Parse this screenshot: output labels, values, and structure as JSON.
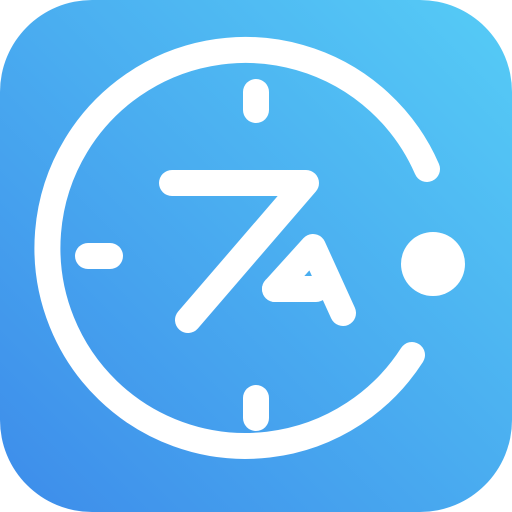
{
  "app_icon": {
    "icon_name": "clock-translate-icon",
    "colors": {
      "gradient_top_right": "#56CCF6",
      "gradient_bottom_left": "#3D8CEA",
      "glyph": "#FFFFFF"
    }
  }
}
